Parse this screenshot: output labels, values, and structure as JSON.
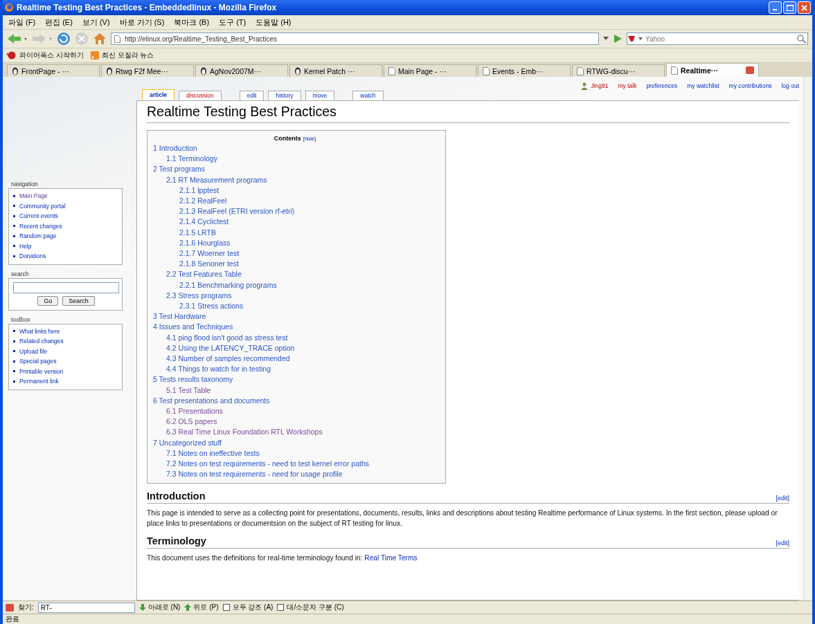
{
  "window": {
    "title": "Realtime Testing Best Practices - Embeddedlinux - Mozilla Firefox"
  },
  "menu": [
    "파일 (F)",
    "편집 (E)",
    "보기 (V)",
    "바로 가기 (S)",
    "북마크 (B)",
    "도구 (T)",
    "도움말 (H)"
  ],
  "address": {
    "url": "http://elinux.org/Realtime_Testing_Best_Practices"
  },
  "search": {
    "placeholder": "Yahoo"
  },
  "bookmarks": [
    {
      "label": "파이어폭스 시작하기",
      "kind": "firefox"
    },
    {
      "label": "최신 모질라 뉴스",
      "kind": "rss"
    }
  ],
  "tabs": [
    {
      "label": "FrontPage - ···",
      "kind": "wiki",
      "selected": false
    },
    {
      "label": "Rtwg F2f Mee···",
      "kind": "wiki",
      "selected": false
    },
    {
      "label": "AgNov2007M···",
      "kind": "wiki",
      "selected": false
    },
    {
      "label": "Kernel Patch ···",
      "kind": "wiki",
      "selected": false
    },
    {
      "label": "Main Page - ···",
      "kind": "page",
      "selected": false
    },
    {
      "label": "Events - Emb···",
      "kind": "page",
      "selected": false
    },
    {
      "label": "RTWG-discu···",
      "kind": "page",
      "selected": false
    },
    {
      "label": "Realtime···",
      "kind": "page",
      "selected": true
    }
  ],
  "personal_tools": [
    {
      "label": "Jing91",
      "kind": "user",
      "missing": true
    },
    {
      "label": "my talk",
      "kind": "link",
      "missing": true
    },
    {
      "label": "preferences",
      "kind": "link",
      "missing": false
    },
    {
      "label": "my watchlist",
      "kind": "link",
      "missing": false
    },
    {
      "label": "my contributions",
      "kind": "link",
      "missing": false
    },
    {
      "label": "log out",
      "kind": "link",
      "missing": false
    }
  ],
  "page_tabs": [
    {
      "label": "article",
      "selected": true,
      "missing": false
    },
    {
      "label": "discussion",
      "selected": false,
      "missing": true
    },
    {
      "label": "edit",
      "selected": false,
      "missing": false
    },
    {
      "label": "history",
      "selected": false,
      "missing": false
    },
    {
      "label": "move",
      "selected": false,
      "missing": false
    },
    {
      "label": "watch",
      "selected": false,
      "missing": false
    }
  ],
  "sidebar": [
    {
      "title": "navigation",
      "kind": "links",
      "items": [
        {
          "label": "Main Page",
          "visited": true
        },
        {
          "label": "Community portal",
          "visited": false
        },
        {
          "label": "Current events",
          "visited": false
        },
        {
          "label": "Recent changes",
          "visited": false
        },
        {
          "label": "Random page",
          "visited": false
        },
        {
          "label": "Help",
          "visited": false
        },
        {
          "label": "Donations",
          "visited": false
        }
      ]
    },
    {
      "title": "search",
      "kind": "search",
      "buttons": [
        "Go",
        "Search"
      ]
    },
    {
      "title": "toolbox",
      "kind": "links",
      "items": [
        {
          "label": "What links here",
          "visited": false
        },
        {
          "label": "Related changes",
          "visited": false
        },
        {
          "label": "Upload file",
          "visited": false
        },
        {
          "label": "Special pages",
          "visited": false
        },
        {
          "label": "Printable version",
          "visited": false
        },
        {
          "label": "Permanent link",
          "visited": false
        }
      ]
    }
  ],
  "article": {
    "title": "Realtime Testing Best Practices",
    "toc": {
      "title": "Contents",
      "toggle": "[hide]",
      "items": [
        {
          "label": "1 Introduction",
          "visited": false,
          "children": [
            {
              "label": "1.1 Terminology",
              "visited": false
            }
          ]
        },
        {
          "label": "2 Test programs",
          "visited": false,
          "children": [
            {
              "label": "2.1 RT Measurement programs",
              "visited": false,
              "children": [
                {
                  "label": "2.1.1 lpptest",
                  "visited": false
                },
                {
                  "label": "2.1.2 RealFeel",
                  "visited": false
                },
                {
                  "label": "2.1.3 RealFeel (ETRI version rf-etri)",
                  "visited": false
                },
                {
                  "label": "2.1.4 Cyclictest",
                  "visited": false
                },
                {
                  "label": "2.1.5 LRTB",
                  "visited": false
                },
                {
                  "label": "2.1.6 Hourglass",
                  "visited": false
                },
                {
                  "label": "2.1.7 Woerner test",
                  "visited": false
                },
                {
                  "label": "2.1.8 Senoner test",
                  "visited": false
                }
              ]
            },
            {
              "label": "2.2 Test Features Table",
              "visited": false,
              "children": [
                {
                  "label": "2.2.1 Benchmarking programs",
                  "visited": false
                }
              ]
            },
            {
              "label": "2.3 Stress programs",
              "visited": false,
              "children": [
                {
                  "label": "2.3.1 Stress actions",
                  "visited": false
                }
              ]
            }
          ]
        },
        {
          "label": "3 Test Hardware",
          "visited": false
        },
        {
          "label": "4 Issues and Techniques",
          "visited": false,
          "children": [
            {
              "label": "4.1 ping flood isn't good as stress test",
              "visited": false
            },
            {
              "label": "4.2 Using the LATENCY_TRACE option",
              "visited": false
            },
            {
              "label": "4.3 Number of samples recommended",
              "visited": false
            },
            {
              "label": "4.4 Things to watch for in testing",
              "visited": false
            }
          ]
        },
        {
          "label": "5 Tests results taxonomy",
          "visited": false,
          "children": [
            {
              "label": "5.1 Test Table",
              "visited": true
            }
          ]
        },
        {
          "label": "6 Test presentations and documents",
          "visited": false,
          "children": [
            {
              "label": "6.1 Presentations",
              "visited": true
            },
            {
              "label": "6.2 OLS papers",
              "visited": true
            },
            {
              "label": "6.3 Real Time Linux Foundation RTL Workshops",
              "visited": true
            }
          ]
        },
        {
          "label": "7 Uncategorized stuff",
          "visited": false,
          "children": [
            {
              "label": "7.1 Notes on ineffective tests",
              "visited": false
            },
            {
              "label": "7.2 Notes on test requirements - need to test kernel error paths",
              "visited": false
            },
            {
              "label": "7.3 Notes on test requirements - need for usage profile",
              "visited": false
            }
          ]
        }
      ]
    },
    "sections": [
      {
        "heading": "Introduction",
        "edit": "[edit]",
        "text": "This page is intended to serve as a collecting point for presentations, documents, results, links and descriptions about testing Realtime performance of Linux systems. In the first section, please upload or place links to presentations or documentsion on the subject of RT testing for linux."
      },
      {
        "heading": "Terminology",
        "edit": "[edit]",
        "text": "This document uses the definitions for real-time terminology found in:",
        "link": "Real Time Terms"
      }
    ]
  },
  "find_bar": {
    "label": "찾기:",
    "value": "RT-",
    "buttons": [
      {
        "label": "아래로 (N)",
        "kind": "down"
      },
      {
        "label": "위로 (P)",
        "kind": "up"
      }
    ],
    "options": [
      {
        "label": "모두 강조 (A)",
        "checked": false
      },
      {
        "label": "대/소문자 구분 (C)",
        "checked": false
      }
    ]
  },
  "status_bar": "완료"
}
